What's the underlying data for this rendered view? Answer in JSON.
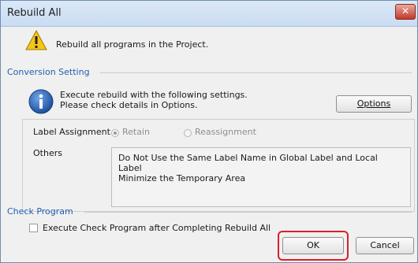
{
  "window": {
    "title": "Rebuild All",
    "close_glyph": "✕"
  },
  "header": {
    "icon": "warning-icon",
    "message": "Rebuild all programs in the Project."
  },
  "conversion": {
    "section_title": "Conversion Setting",
    "icon": "info-icon",
    "message_line1": "Execute rebuild with the following settings.",
    "message_line2": "Please check details in Options.",
    "options_button": "Options",
    "label_assignment": {
      "label": "Label Assignment",
      "options": [
        "Retain",
        "Reassignment"
      ],
      "selected": "Retain"
    },
    "others": {
      "label": "Others",
      "lines": [
        "Do Not Use the Same Label Name in Global Label and Local Label",
        "Minimize the Temporary Area"
      ]
    }
  },
  "check_program": {
    "section_title": "Check Program",
    "checkbox_label": "Execute Check Program after Completing Rebuild All",
    "checked": false
  },
  "footer": {
    "ok_label": "OK",
    "cancel_label": "Cancel",
    "highlight_color": "#d9202a"
  }
}
